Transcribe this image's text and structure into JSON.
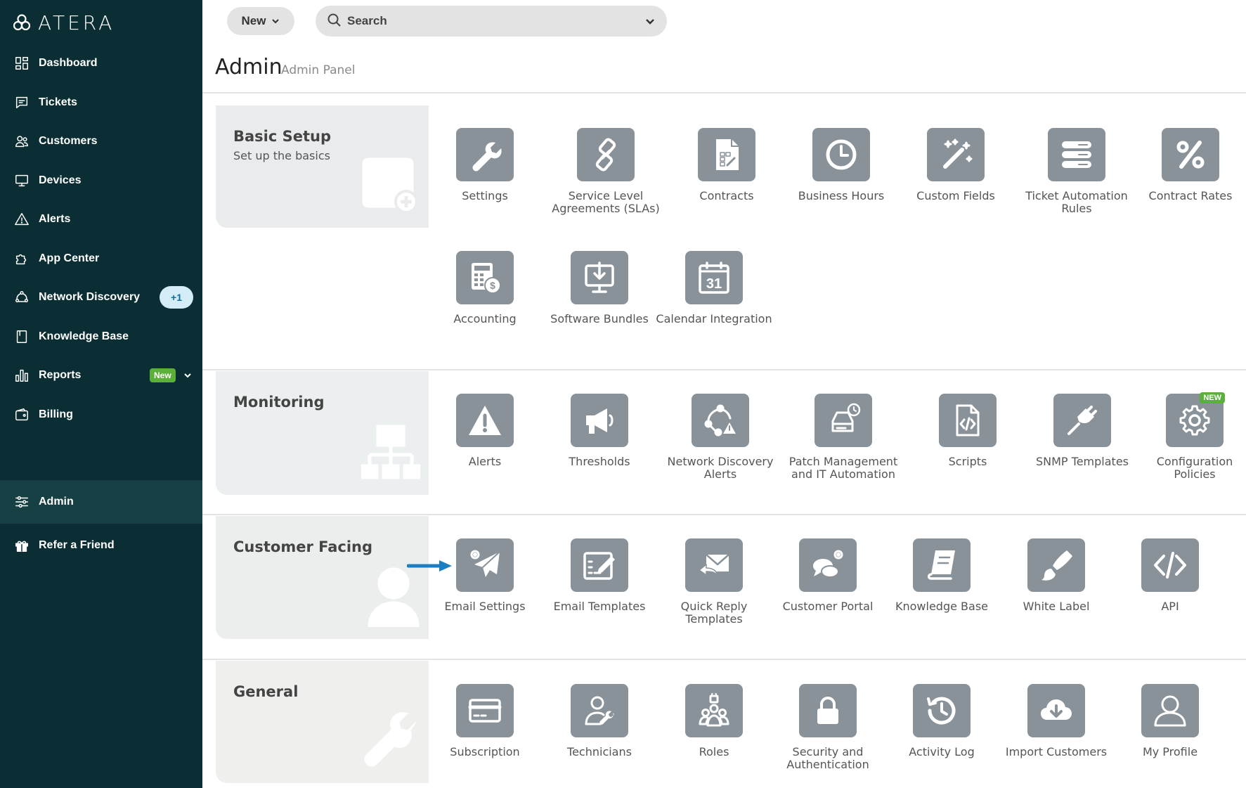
{
  "app": {
    "logo_text": "ATERA"
  },
  "sidebar": {
    "items": [
      {
        "label": "Dashboard"
      },
      {
        "label": "Tickets"
      },
      {
        "label": "Customers"
      },
      {
        "label": "Devices"
      },
      {
        "label": "Alerts"
      },
      {
        "label": "App Center"
      },
      {
        "label": "Network Discovery",
        "badge": "+1"
      },
      {
        "label": "Knowledge Base"
      },
      {
        "label": "Reports",
        "badge": "New"
      },
      {
        "label": "Billing"
      },
      {
        "label": "Admin",
        "active": true
      },
      {
        "label": "Refer a Friend"
      }
    ]
  },
  "topbar": {
    "new_label": "New",
    "search_label": "Search"
  },
  "header": {
    "title": "Admin",
    "subtitle": "Admin Panel"
  },
  "sections": [
    {
      "title": "Basic Setup",
      "subtitle": "Set up the basics",
      "tiles": [
        {
          "label": "Settings",
          "icon": "wrench-icon"
        },
        {
          "label": "Service Level Agreements (SLAs)",
          "icon": "link-icon"
        },
        {
          "label": "Contracts",
          "icon": "contract-icon"
        },
        {
          "label": "Business Hours",
          "icon": "clock-icon"
        },
        {
          "label": "Custom Fields",
          "icon": "magic-wand-icon"
        },
        {
          "label": "Ticket Automation Rules",
          "icon": "server-stack-icon"
        },
        {
          "label": "Contract Rates",
          "icon": "percent-icon"
        },
        {
          "label": "Accounting",
          "icon": "calculator-icon"
        },
        {
          "label": "Software Bundles",
          "icon": "download-monitor-icon"
        },
        {
          "label": "Calendar Integration",
          "icon": "calendar-icon",
          "text": "31"
        }
      ]
    },
    {
      "title": "Monitoring",
      "tiles": [
        {
          "label": "Alerts",
          "icon": "warning-icon"
        },
        {
          "label": "Thresholds",
          "icon": "megaphone-icon"
        },
        {
          "label": "Network Discovery Alerts",
          "icon": "network-alert-icon"
        },
        {
          "label": "Patch Management and IT Automation",
          "icon": "patch-drive-icon"
        },
        {
          "label": "Scripts",
          "icon": "script-file-icon"
        },
        {
          "label": "SNMP Templates",
          "icon": "plug-icon"
        },
        {
          "label": "Configuration Policies",
          "icon": "gear-icon",
          "badge": "NEW"
        }
      ]
    },
    {
      "title": "Customer Facing",
      "tiles": [
        {
          "label": "Email Settings",
          "icon": "paper-plane-gear-icon"
        },
        {
          "label": "Email Templates",
          "icon": "template-edit-icon"
        },
        {
          "label": "Quick Reply Templates",
          "icon": "envelope-reply-icon"
        },
        {
          "label": "Customer Portal",
          "icon": "chat-gear-icon"
        },
        {
          "label": "Knowledge Base",
          "icon": "book-icon"
        },
        {
          "label": "White Label",
          "icon": "paintbrush-icon"
        },
        {
          "label": "API",
          "icon": "code-icon"
        }
      ]
    },
    {
      "title": "General",
      "tiles": [
        {
          "label": "Subscription",
          "icon": "credit-card-icon"
        },
        {
          "label": "Technicians",
          "icon": "technician-icon"
        },
        {
          "label": "Roles",
          "icon": "roles-icon"
        },
        {
          "label": "Security and Authentication",
          "icon": "lock-icon"
        },
        {
          "label": "Activity Log",
          "icon": "history-icon"
        },
        {
          "label": "Import Customers",
          "icon": "cloud-download-icon"
        },
        {
          "label": "My Profile",
          "icon": "user-icon"
        }
      ]
    }
  ],
  "colors": {
    "sidebar_bg": "#0a2e33",
    "active_bg": "#174045",
    "tile_bg": "#8a9299",
    "badge_green": "#5bb03a",
    "arrow_blue": "#1b7ec2"
  }
}
